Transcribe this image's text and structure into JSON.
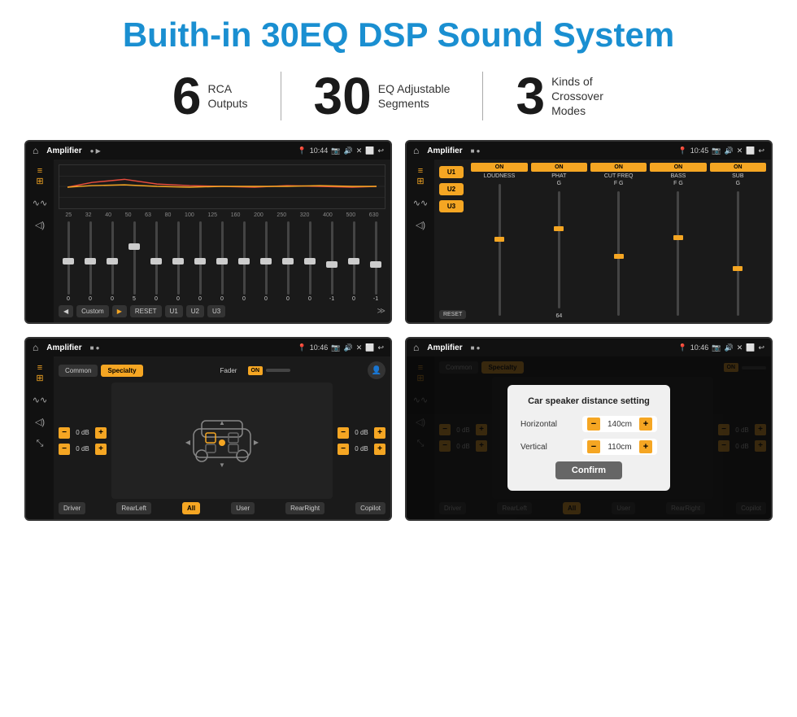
{
  "title": "Buith-in 30EQ DSP Sound System",
  "stats": [
    {
      "number": "6",
      "desc_line1": "RCA",
      "desc_line2": "Outputs"
    },
    {
      "number": "30",
      "desc_line1": "EQ Adjustable",
      "desc_line2": "Segments"
    },
    {
      "number": "3",
      "desc_line1": "Kinds of",
      "desc_line2": "Crossover Modes"
    }
  ],
  "screen1": {
    "status": {
      "home": "⌂",
      "title": "Amplifier",
      "dots": "● ▶",
      "time": "10:44",
      "icons": "📷 🔊 ✕ ⬜ ↩"
    },
    "eq_frequencies": [
      "25",
      "32",
      "40",
      "50",
      "63",
      "80",
      "100",
      "125",
      "160",
      "200",
      "250",
      "320",
      "400",
      "500",
      "630"
    ],
    "eq_values": [
      "0",
      "0",
      "0",
      "5",
      "0",
      "0",
      "0",
      "0",
      "0",
      "0",
      "0",
      "0",
      "-1",
      "0",
      "-1"
    ],
    "buttons": [
      "◀",
      "Custom",
      "▶",
      "RESET",
      "U1",
      "U2",
      "U3"
    ]
  },
  "screen2": {
    "status": {
      "home": "⌂",
      "title": "Amplifier",
      "dots": "■ ●",
      "time": "10:45"
    },
    "presets": [
      "U1",
      "U2",
      "U3"
    ],
    "controls": [
      {
        "toggle": "ON",
        "label": "LOUDNESS",
        "value": ""
      },
      {
        "toggle": "ON",
        "label": "PHAT",
        "value": "G"
      },
      {
        "toggle": "ON",
        "label": "CUT FREQ",
        "value": "F  G"
      },
      {
        "toggle": "ON",
        "label": "BASS",
        "value": "F  G"
      },
      {
        "toggle": "ON",
        "label": "SUB",
        "value": "G"
      }
    ],
    "reset": "RESET"
  },
  "screen3": {
    "status": {
      "home": "⌂",
      "title": "Amplifier",
      "dots": "■ ●",
      "time": "10:46"
    },
    "tabs": [
      "Common",
      "Specialty"
    ],
    "fader_label": "Fader",
    "fader_toggle": "ON",
    "channel_labels": [
      "0 dB",
      "0 dB",
      "0 dB",
      "0 dB"
    ],
    "bottom_buttons": [
      "Driver",
      "RearLeft",
      "All",
      "User",
      "RearRight",
      "Copilot"
    ]
  },
  "screen4": {
    "status": {
      "home": "⌂",
      "title": "Amplifier",
      "dots": "■ ●",
      "time": "10:46"
    },
    "tabs": [
      "Common",
      "Specialty"
    ],
    "fader_toggle": "ON",
    "dialog": {
      "title": "Car speaker distance setting",
      "horizontal_label": "Horizontal",
      "horizontal_value": "140cm",
      "vertical_label": "Vertical",
      "vertical_value": "110cm",
      "confirm_label": "Confirm"
    },
    "channel_labels": [
      "0 dB",
      "0 dB"
    ],
    "bottom_buttons": [
      "Driver",
      "RearLeft",
      "All",
      "User",
      "RearRight",
      "Copilot"
    ]
  }
}
